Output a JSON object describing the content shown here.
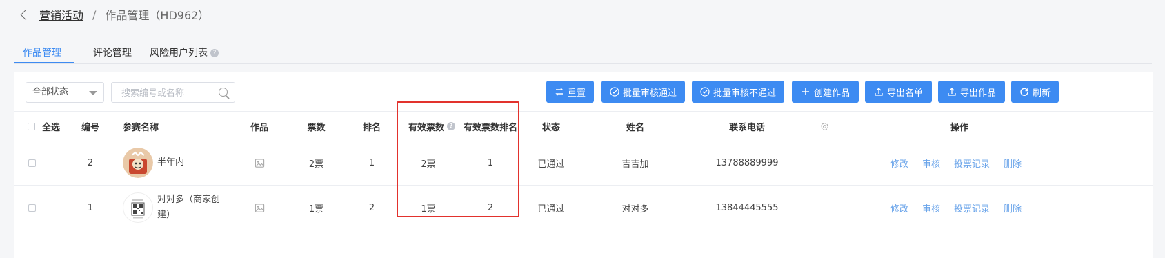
{
  "breadcrumb": {
    "parent": "营销活动",
    "separator": "/",
    "current": "作品管理（HD962）"
  },
  "tabs": [
    {
      "label": "作品管理",
      "active": true
    },
    {
      "label": "评论管理",
      "active": false
    },
    {
      "label": "风险用户列表",
      "active": false,
      "help_icon": "?"
    }
  ],
  "filters": {
    "status_select": "全部状态",
    "search_placeholder": "搜索编号或名称"
  },
  "toolbar": [
    {
      "label": "重置",
      "icon": "reset-icon"
    },
    {
      "label": "批量审核通过",
      "icon": "check-circle-icon"
    },
    {
      "label": "批量审核不通过",
      "icon": "check-circle-icon"
    },
    {
      "label": "创建作品",
      "icon": "plus-icon"
    },
    {
      "label": "导出名单",
      "icon": "upload-icon"
    },
    {
      "label": "导出作品",
      "icon": "upload-icon"
    },
    {
      "label": "刷新",
      "icon": "refresh-icon"
    }
  ],
  "table": {
    "select_all": "全选",
    "columns": [
      "编号",
      "参赛名称",
      "作品",
      "票数",
      "排名",
      "有效票数",
      "有效票数排名",
      "状态",
      "姓名",
      "联系电话",
      "操作"
    ],
    "valid_votes_help": "?",
    "rows": [
      {
        "id": "2",
        "name": "半年内",
        "votes": "2票",
        "rank": "1",
        "valid_votes": "2票",
        "valid_rank": "1",
        "status": "已通过",
        "person": "吉吉加",
        "phone": "13788889999"
      },
      {
        "id": "1",
        "name": "对对多（商家创建）",
        "votes": "1票",
        "rank": "2",
        "valid_votes": "1票",
        "valid_rank": "2",
        "status": "已通过",
        "person": "对对多",
        "phone": "13844445555"
      }
    ],
    "actions": [
      "修改",
      "审核",
      "投票记录",
      "删除"
    ]
  },
  "colors": {
    "primary": "#3d8bf2",
    "link": "#6aa4ea",
    "highlight": "#e2322d"
  }
}
